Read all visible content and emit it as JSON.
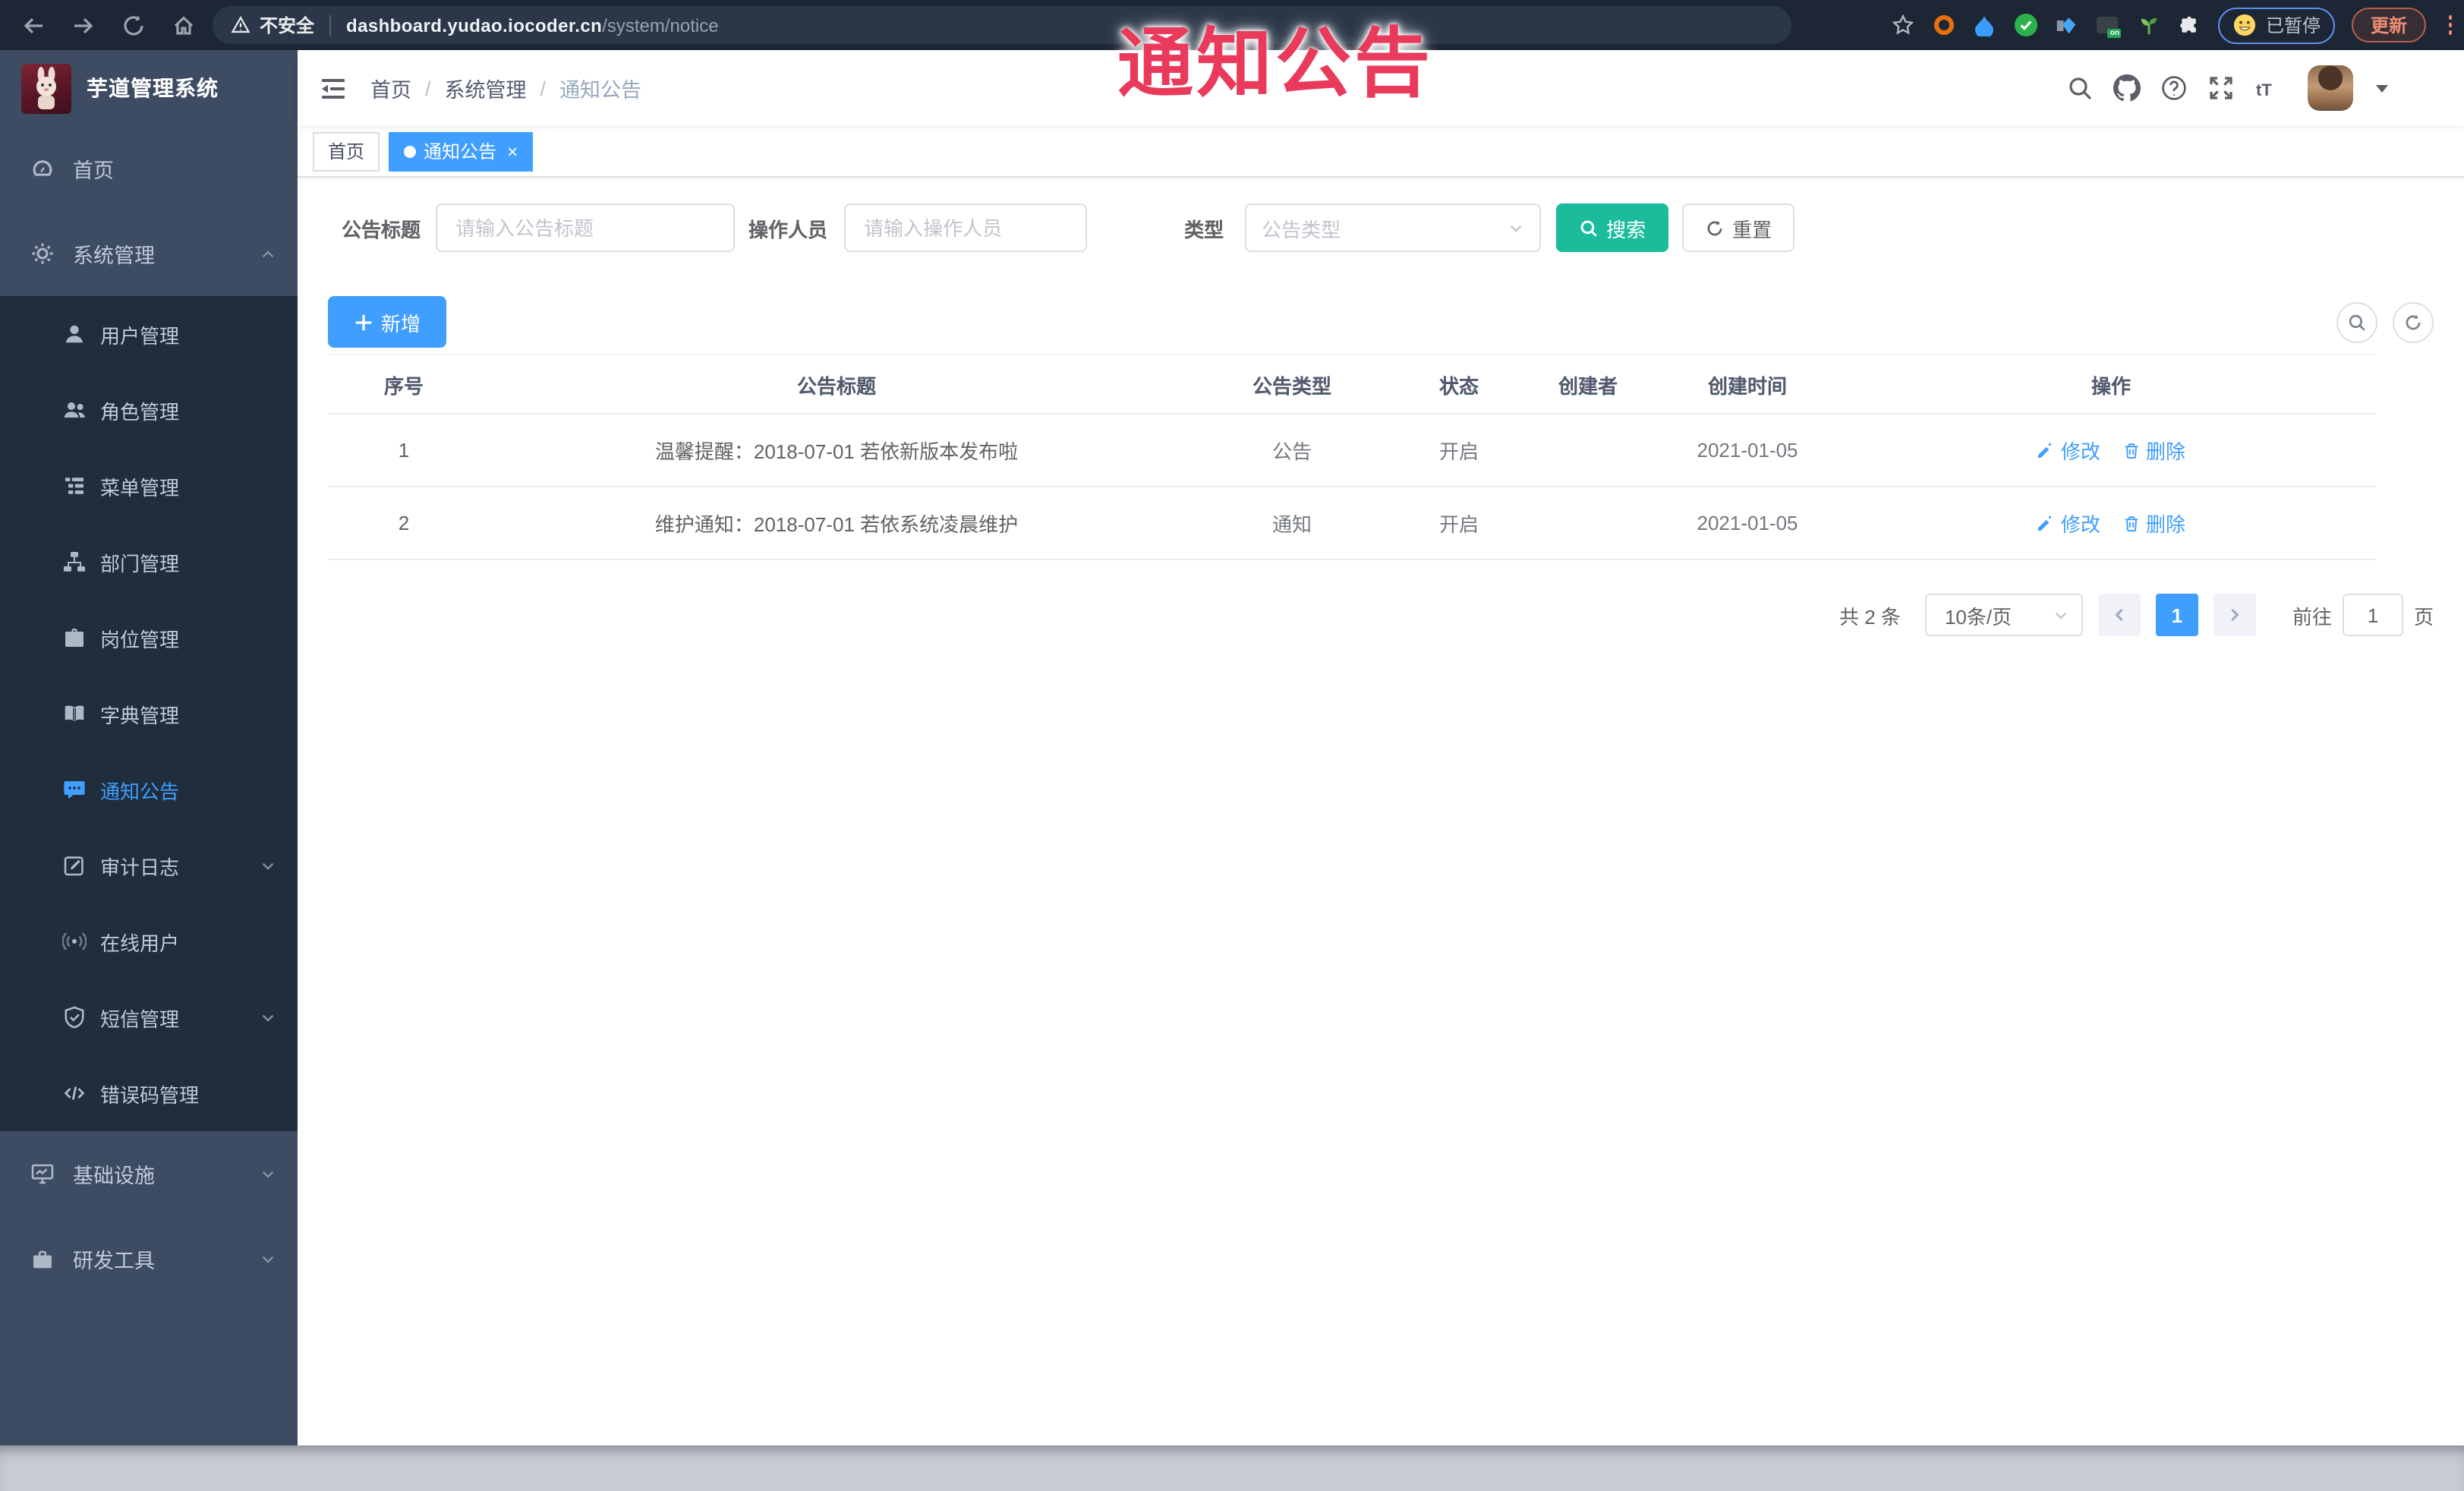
{
  "browser": {
    "security_label": "不安全",
    "url_host": "dashboard.yudao.iocoder.cn",
    "url_path": "/system/notice",
    "paused_label": "已暂停",
    "update_label": "更新"
  },
  "annotation": {
    "text": "通知公告"
  },
  "sidebar": {
    "title": "芋道管理系统",
    "home": {
      "label": "首页"
    },
    "system": {
      "label": "系统管理"
    },
    "system_children": [
      {
        "label": "用户管理"
      },
      {
        "label": "角色管理"
      },
      {
        "label": "菜单管理"
      },
      {
        "label": "部门管理"
      },
      {
        "label": "岗位管理"
      },
      {
        "label": "字典管理"
      },
      {
        "label": "通知公告",
        "active": true
      },
      {
        "label": "审计日志",
        "has_children": true
      },
      {
        "label": "在线用户"
      },
      {
        "label": "短信管理",
        "has_children": true
      },
      {
        "label": "错误码管理"
      }
    ],
    "infra": {
      "label": "基础设施"
    },
    "dev": {
      "label": "研发工具"
    }
  },
  "navbar": {
    "breadcrumb": [
      "首页",
      "系统管理",
      "通知公告"
    ],
    "separator": "/"
  },
  "tabs": [
    {
      "label": "首页"
    },
    {
      "label": "通知公告",
      "active": true,
      "close": "×"
    }
  ],
  "filters": {
    "title_label": "公告标题",
    "title_placeholder": "请输入公告标题",
    "operator_label": "操作人员",
    "operator_placeholder": "请输入操作人员",
    "type_label": "类型",
    "type_placeholder": "公告类型",
    "search_label": "搜索",
    "reset_label": "重置"
  },
  "toolbar": {
    "add_label": "新增"
  },
  "table": {
    "headers": [
      "序号",
      "公告标题",
      "公告类型",
      "状态",
      "创建者",
      "创建时间",
      "操作"
    ],
    "rows": [
      {
        "no": "1",
        "title": "温馨提醒：2018-07-01 若依新版本发布啦",
        "type": "公告",
        "status": "开启",
        "creator": "",
        "created": "2021-01-05"
      },
      {
        "no": "2",
        "title": "维护通知：2018-07-01 若依系统凌晨维护",
        "type": "通知",
        "status": "开启",
        "creator": "",
        "created": "2021-01-05"
      }
    ],
    "edit_label": "修改",
    "delete_label": "删除"
  },
  "pagination": {
    "total": "共 2 条",
    "page_size": "10条/页",
    "current": "1",
    "goto_label": "前往",
    "goto_value": "1",
    "unit_label": "页"
  },
  "colors": {
    "accent": "#409eff",
    "search_button": "#1abc9c",
    "annotation_red": "#ea3a5c",
    "sidebar_bg": "#3d4b63",
    "submenu_bg": "#1f2d3d",
    "browser_bar": "#1d2634"
  }
}
